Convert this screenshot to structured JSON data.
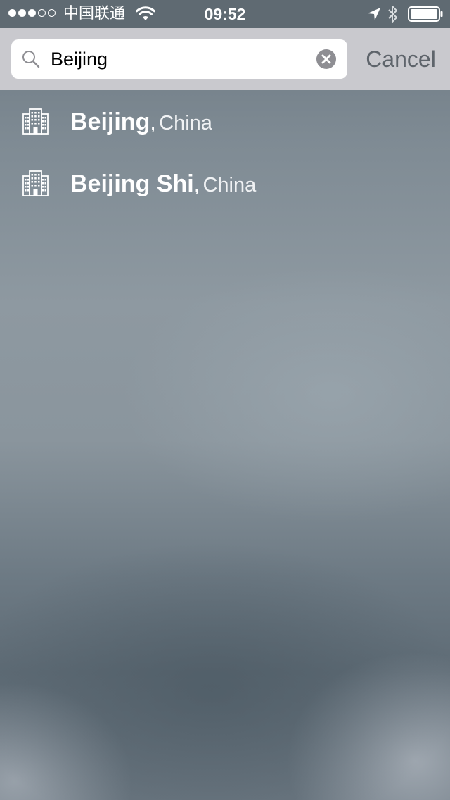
{
  "status_bar": {
    "carrier": "中国联通",
    "time": "09:52",
    "signal_total": 5,
    "signal_filled": 3,
    "battery_level": 1.0,
    "icons": [
      "signal-dots-icon",
      "wifi-icon",
      "location-arrow-icon",
      "bluetooth-icon",
      "battery-icon"
    ]
  },
  "search": {
    "value": "Beijing",
    "icon": "search-icon",
    "clear_icon": "clear-circle-icon",
    "cancel_label": "Cancel"
  },
  "results": [
    {
      "city": "Beijing",
      "separator": ",",
      "country": "China",
      "icon": "building-icon"
    },
    {
      "city": "Beijing Shi",
      "separator": ",",
      "country": "China",
      "icon": "building-icon"
    }
  ],
  "colors": {
    "status_bar_bg": "#5f6a72",
    "search_header_bg": "#c9c9ce",
    "cancel_text": "#5e646b",
    "result_text": "#ffffff"
  }
}
